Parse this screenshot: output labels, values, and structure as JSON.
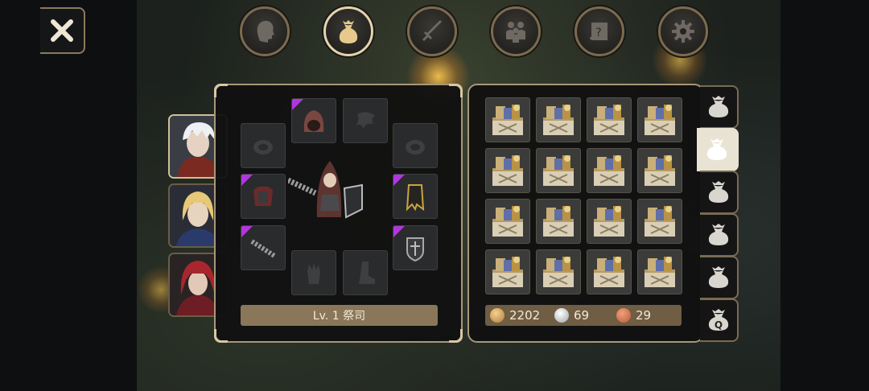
{
  "top_tabs": [
    {
      "name": "character-tab",
      "icon": "head-silhouette-icon",
      "active": false
    },
    {
      "name": "inventory-tab",
      "icon": "bag-icon",
      "active": true
    },
    {
      "name": "skills-tab",
      "icon": "sword-icon",
      "active": false
    },
    {
      "name": "party-tab",
      "icon": "party-icon",
      "active": false
    },
    {
      "name": "quest-tab",
      "icon": "scroll-icon",
      "active": false
    },
    {
      "name": "settings-tab",
      "icon": "gear-icon",
      "active": false
    }
  ],
  "party": [
    {
      "name": "white-haired-warrior",
      "active": true
    },
    {
      "name": "blonde-elf",
      "active": false
    },
    {
      "name": "red-haired-priest",
      "active": false
    }
  ],
  "equipment": {
    "level_label": "Lv. 1 祭司"
  },
  "inventory": {
    "rows": 4,
    "cols": 4,
    "item": "treasure-chest-icon"
  },
  "currency": {
    "gold": "2202",
    "silver": "69",
    "copper": "29"
  },
  "side_tabs": [
    {
      "icon": "bag-icon",
      "active": false,
      "label": ""
    },
    {
      "icon": "bag-icon",
      "active": true,
      "label": ""
    },
    {
      "icon": "bag-icon",
      "active": false,
      "label": ""
    },
    {
      "icon": "bag-icon",
      "active": false,
      "label": ""
    },
    {
      "icon": "bag-icon",
      "active": false,
      "label": ""
    },
    {
      "icon": "bag-q-icon",
      "active": false,
      "label": "Q"
    }
  ],
  "colors": {
    "panel_border": "#a8977a",
    "rare_marker": "#b236e0",
    "level_bar": "#8a7659",
    "currency_bar": "#6f5d44"
  }
}
